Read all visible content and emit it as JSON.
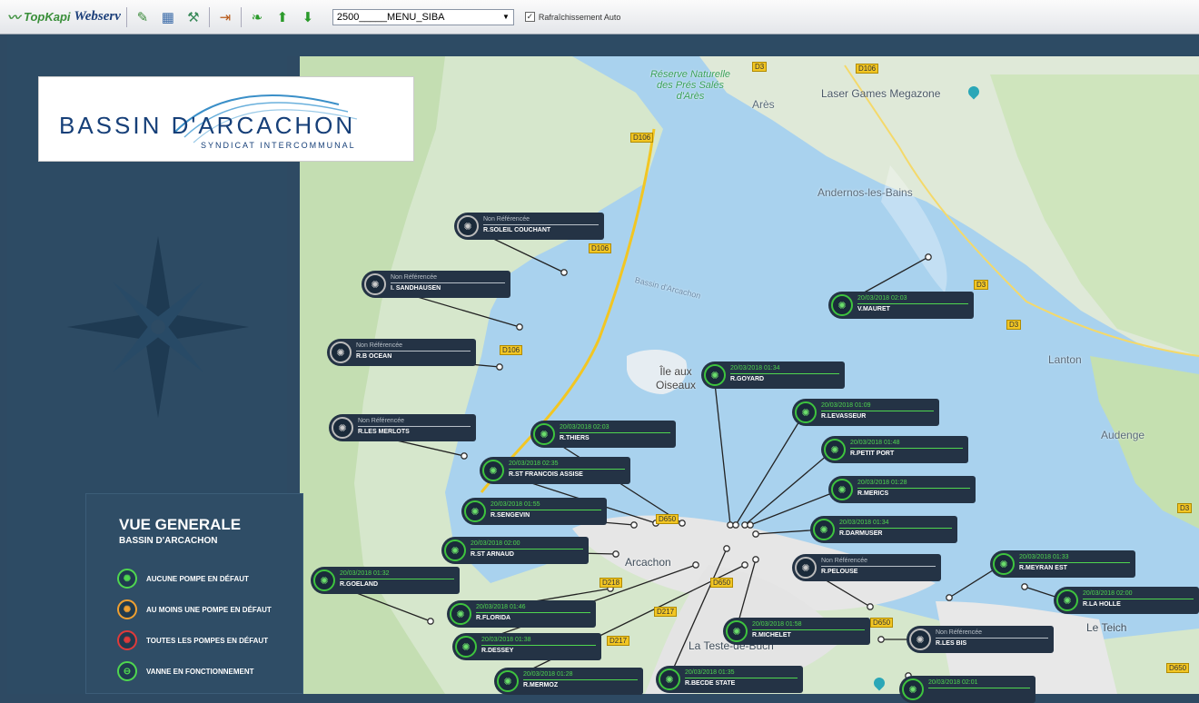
{
  "toolbar": {
    "brand_top": "TopKapi",
    "brand_web": "Webserv",
    "menu_value": "2500_____MENU_SIBA",
    "refresh_label": "Rafraîchissement Auto",
    "refresh_checked": true
  },
  "logo": {
    "title": "BASSIN D'ARCACHON",
    "subtitle": "SYNDICAT INTERCOMMUNAL"
  },
  "legend": {
    "title": "VUE GENERALE",
    "subtitle": "BASSIN D'ARCACHON",
    "items": [
      {
        "label": "AUCUNE POMPE EN DÉFAUT",
        "color": "#4fd64f"
      },
      {
        "label": "AU MOINS UNE POMPE EN DÉFAUT",
        "color": "#f0a030"
      },
      {
        "label": "TOUTES LES POMPES EN DÉFAUT",
        "color": "#e03a3a"
      },
      {
        "label": "VANNE EN FONCTIONNEMENT",
        "color": "#4fd64f"
      }
    ]
  },
  "map": {
    "places": [
      "Réserve Naturelle des Prés Salés d'Arès",
      "Arès",
      "Laser Games Megazone",
      "Andernos-les-Bains",
      "Bassin d'Arcachon",
      "Île aux Oiseaux",
      "Lanton",
      "Audenge",
      "Arcachon",
      "La Teste-de-Buch",
      "Le Teich"
    ],
    "roads": [
      "D3",
      "D106",
      "D106",
      "D106",
      "D106",
      "D3",
      "D3",
      "D650",
      "D218",
      "D650",
      "D217",
      "D217",
      "D650",
      "D650",
      "D3"
    ]
  },
  "stations": [
    {
      "date": "Non Référencée",
      "name": "R.SOLEIL COUCHANT",
      "status": "off"
    },
    {
      "date": "Non Référencée",
      "name": "I. SANDHAUSEN",
      "status": "off"
    },
    {
      "date": "Non Référencée",
      "name": "R.B OCEAN",
      "status": "off"
    },
    {
      "date": "Non Référencée",
      "name": "R.LES MERLOTS",
      "status": "off"
    },
    {
      "date": "20/03/2018 02:03",
      "name": "V.MAURET",
      "status": "ok"
    },
    {
      "date": "20/03/2018 01:34",
      "name": "R.GOYARD",
      "status": "ok"
    },
    {
      "date": "20/03/2018 01:09",
      "name": "R.LEVASSEUR",
      "status": "ok"
    },
    {
      "date": "20/03/2018 02:03",
      "name": "R.THIERS",
      "status": "ok"
    },
    {
      "date": "20/03/2018 01:48",
      "name": "R.PETIT PORT",
      "status": "ok"
    },
    {
      "date": "20/03/2018 02:35",
      "name": "R.ST FRANCOIS ASSISE",
      "status": "ok"
    },
    {
      "date": "20/03/2018 01:28",
      "name": "R.MERICS",
      "status": "ok"
    },
    {
      "date": "20/03/2018 01:55",
      "name": "R.SENGEVIN",
      "status": "ok"
    },
    {
      "date": "20/03/2018 01:34",
      "name": "R.DARMUSER",
      "status": "ok"
    },
    {
      "date": "20/03/2018 02:00",
      "name": "R.ST ARNAUD",
      "status": "ok"
    },
    {
      "date": "Non Référencée",
      "name": "R.PELOUSE",
      "status": "off"
    },
    {
      "date": "20/03/2018 01:33",
      "name": "R.MEYRAN EST",
      "status": "ok"
    },
    {
      "date": "20/03/2018 01:32",
      "name": "R.GOELAND",
      "status": "ok"
    },
    {
      "date": "20/03/2018 02:00",
      "name": "R.LA HOLLE",
      "status": "ok"
    },
    {
      "date": "20/03/2018 01:46",
      "name": "R.FLORIDA",
      "status": "ok"
    },
    {
      "date": "20/03/2018 01:58",
      "name": "R.MICHELET",
      "status": "ok"
    },
    {
      "date": "Non Référencée",
      "name": "R.LES BIS",
      "status": "off"
    },
    {
      "date": "20/03/2018 01:38",
      "name": "R.DESSEY",
      "status": "ok"
    },
    {
      "date": "20/03/2018 01:28",
      "name": "R.MERMOZ",
      "status": "ok"
    },
    {
      "date": "20/03/2018 01:35",
      "name": "R.BECDE STATE",
      "status": "ok"
    },
    {
      "date": "20/03/2018 02:01",
      "name": "",
      "status": "ok"
    }
  ]
}
